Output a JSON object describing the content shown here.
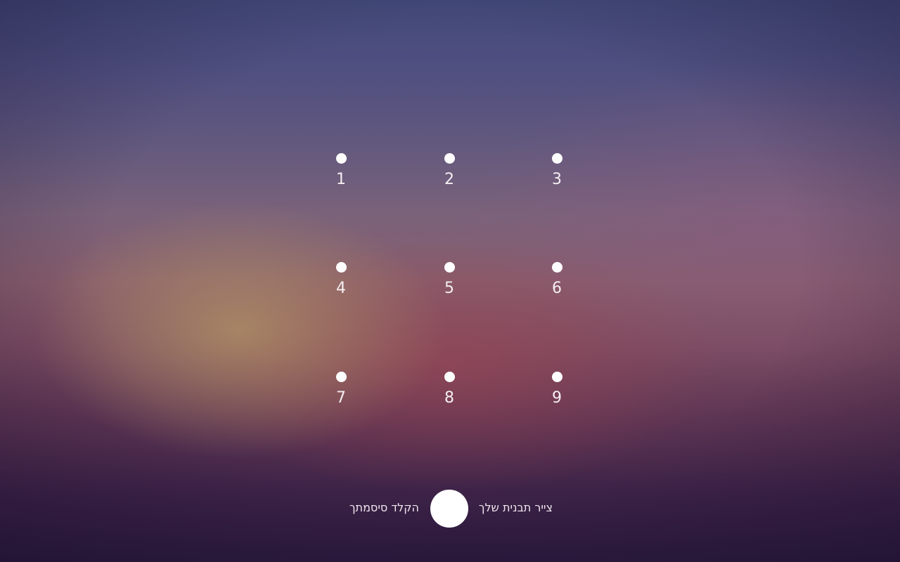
{
  "pattern_grid": {
    "nodes": [
      {
        "label": "1"
      },
      {
        "label": "2"
      },
      {
        "label": "3"
      },
      {
        "label": "4"
      },
      {
        "label": "5"
      },
      {
        "label": "6"
      },
      {
        "label": "7"
      },
      {
        "label": "8"
      },
      {
        "label": "9"
      }
    ]
  },
  "footer": {
    "draw_pattern_label": "צייר תבנית שלך",
    "enter_password_label": "הקלד סיסמתך"
  },
  "colors": {
    "dot": "#ffffff",
    "text": "#f4eef2",
    "background_top": "#434a7a",
    "background_bottom": "#2b1a3d"
  }
}
